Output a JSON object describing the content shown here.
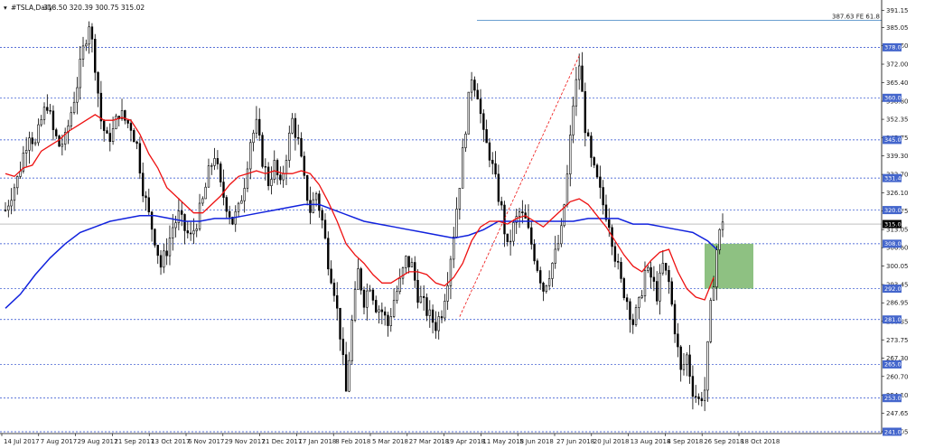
{
  "header": {
    "symbol": "#TSLA,Daily",
    "ohlc": "318.50 320.39 300.75 315.02"
  },
  "colors": {
    "up": "#000000",
    "down": "#000000",
    "ma_fast": "#ee1111",
    "ma_slow": "#1122dd",
    "level_line": "#2244cc",
    "level_label": "#4466cc",
    "zone": "#7ab66c",
    "fib_line": "#3a7fc0",
    "fib_text": "#3a7fc0",
    "price_tag": "#000000"
  },
  "chart_data": {
    "type": "candlestick",
    "title": "#TSLA,Daily",
    "ylim": [
      241.0,
      391.0
    ],
    "y_ticks": [
      "391.15",
      "385.05",
      "378.60",
      "372.00",
      "365.40",
      "358.80",
      "352.35",
      "345.75",
      "339.30",
      "332.70",
      "326.10",
      "319.75",
      "313.05",
      "306.60",
      "300.05",
      "293.45",
      "286.95",
      "280.35",
      "273.75",
      "267.30",
      "260.70",
      "254.10",
      "247.65",
      "241.05"
    ],
    "x_ticks": [
      "14 Jul 2017",
      "7 Aug 2017",
      "29 Aug 2017",
      "21 Sep 2017",
      "13 Oct 2017",
      "6 Nov 2017",
      "29 Nov 2017",
      "21 Dec 2017",
      "17 Jan 2018",
      "8 Feb 2018",
      "5 Mar 2018",
      "27 Mar 2018",
      "19 Apr 2018",
      "11 May 2018",
      "5 Jun 2018",
      "27 Jun 2018",
      "20 Jul 2018",
      "13 Aug 2018",
      "4 Sep 2018",
      "26 Sep 2018",
      "18 Oct 2018"
    ],
    "levels": [
      {
        "value": 378.0,
        "label": "378.00"
      },
      {
        "value": 360.0,
        "label": "360.00"
      },
      {
        "value": 345.0,
        "label": "345.00"
      },
      {
        "value": 331.4,
        "label": "331.40"
      },
      {
        "value": 320.0,
        "label": "320.00"
      },
      {
        "value": 308.0,
        "label": "308.00"
      },
      {
        "value": 292.0,
        "label": "292.00"
      },
      {
        "value": 281.0,
        "label": "281.00"
      },
      {
        "value": 265.0,
        "label": "265.00"
      },
      {
        "value": 253.0,
        "label": "253.00"
      },
      {
        "value": 241.0,
        "label": "241.00"
      }
    ],
    "current_price": {
      "value": 315.02,
      "label": "315.02"
    },
    "fib": {
      "value": 387.63,
      "label": "387.63 FE 61.8"
    },
    "zone": {
      "y_top": 308.0,
      "y_bottom": 292.0
    },
    "close_points": [
      [
        0,
        320
      ],
      [
        4,
        326
      ],
      [
        8,
        331
      ],
      [
        12,
        340
      ],
      [
        16,
        348
      ],
      [
        20,
        343
      ],
      [
        24,
        352
      ],
      [
        28,
        358
      ],
      [
        32,
        348
      ],
      [
        36,
        343
      ],
      [
        40,
        345
      ],
      [
        44,
        355
      ],
      [
        48,
        365
      ],
      [
        52,
        377
      ],
      [
        56,
        387
      ],
      [
        60,
        372
      ],
      [
        64,
        352
      ],
      [
        68,
        345
      ],
      [
        72,
        348
      ],
      [
        76,
        355
      ],
      [
        80,
        352
      ],
      [
        84,
        350
      ],
      [
        88,
        343
      ],
      [
        92,
        328
      ],
      [
        96,
        318
      ],
      [
        100,
        310
      ],
      [
        104,
        300
      ],
      [
        108,
        306
      ],
      [
        112,
        314
      ],
      [
        116,
        318
      ],
      [
        120,
        313
      ],
      [
        124,
        310
      ],
      [
        128,
        316
      ],
      [
        132,
        323
      ],
      [
        136,
        333
      ],
      [
        140,
        340
      ],
      [
        144,
        328
      ],
      [
        148,
        322
      ],
      [
        152,
        316
      ],
      [
        156,
        320
      ],
      [
        160,
        330
      ],
      [
        164,
        345
      ],
      [
        168,
        350
      ],
      [
        172,
        338
      ],
      [
        176,
        330
      ],
      [
        180,
        336
      ],
      [
        184,
        328
      ],
      [
        188,
        340
      ],
      [
        192,
        352
      ],
      [
        196,
        344
      ],
      [
        200,
        330
      ],
      [
        204,
        320
      ],
      [
        208,
        326
      ],
      [
        212,
        316
      ],
      [
        216,
        302
      ],
      [
        220,
        292
      ],
      [
        224,
        276
      ],
      [
        228,
        255
      ],
      [
        232,
        280
      ],
      [
        236,
        298
      ],
      [
        240,
        288
      ],
      [
        244,
        294
      ],
      [
        248,
        286
      ],
      [
        252,
        284
      ],
      [
        256,
        279
      ],
      [
        260,
        288
      ],
      [
        264,
        294
      ],
      [
        268,
        302
      ],
      [
        272,
        300
      ],
      [
        276,
        290
      ],
      [
        280,
        286
      ],
      [
        284,
        282
      ],
      [
        288,
        279
      ],
      [
        292,
        284
      ],
      [
        296,
        296
      ],
      [
        300,
        312
      ],
      [
        304,
        330
      ],
      [
        308,
        350
      ],
      [
        312,
        368
      ],
      [
        316,
        362
      ],
      [
        320,
        346
      ],
      [
        324,
        340
      ],
      [
        328,
        330
      ],
      [
        332,
        320
      ],
      [
        336,
        306
      ],
      [
        340,
        314
      ],
      [
        344,
        319
      ],
      [
        348,
        316
      ],
      [
        352,
        308
      ],
      [
        356,
        300
      ],
      [
        360,
        292
      ],
      [
        364,
        298
      ],
      [
        368,
        304
      ],
      [
        372,
        312
      ],
      [
        376,
        332
      ],
      [
        380,
        358
      ],
      [
        384,
        372
      ],
      [
        388,
        350
      ],
      [
        392,
        337
      ],
      [
        396,
        330
      ],
      [
        400,
        322
      ],
      [
        404,
        316
      ],
      [
        408,
        304
      ],
      [
        412,
        294
      ],
      [
        416,
        288
      ],
      [
        420,
        280
      ],
      [
        424,
        286
      ],
      [
        428,
        298
      ],
      [
        432,
        296
      ],
      [
        436,
        290
      ],
      [
        440,
        300
      ],
      [
        444,
        294
      ],
      [
        448,
        278
      ],
      [
        452,
        262
      ],
      [
        456,
        268
      ],
      [
        460,
        256
      ],
      [
        464,
        252
      ],
      [
        468,
        256
      ],
      [
        472,
        285
      ],
      [
        476,
        306
      ],
      [
        480,
        317
      ]
    ],
    "ma_fast": [
      [
        0,
        333
      ],
      [
        6,
        332
      ],
      [
        12,
        335
      ],
      [
        18,
        336
      ],
      [
        24,
        341
      ],
      [
        30,
        343
      ],
      [
        36,
        345
      ],
      [
        42,
        348
      ],
      [
        48,
        350
      ],
      [
        54,
        352
      ],
      [
        60,
        354
      ],
      [
        66,
        352
      ],
      [
        72,
        352
      ],
      [
        78,
        353
      ],
      [
        84,
        352
      ],
      [
        90,
        347
      ],
      [
        96,
        340
      ],
      [
        102,
        335
      ],
      [
        108,
        328
      ],
      [
        114,
        325
      ],
      [
        120,
        322
      ],
      [
        126,
        319
      ],
      [
        132,
        319
      ],
      [
        138,
        322
      ],
      [
        144,
        325
      ],
      [
        150,
        329
      ],
      [
        156,
        332
      ],
      [
        162,
        333
      ],
      [
        168,
        334
      ],
      [
        174,
        333
      ],
      [
        180,
        334
      ],
      [
        186,
        333
      ],
      [
        192,
        333
      ],
      [
        198,
        334
      ],
      [
        204,
        333
      ],
      [
        210,
        329
      ],
      [
        216,
        323
      ],
      [
        222,
        316
      ],
      [
        228,
        308
      ],
      [
        234,
        304
      ],
      [
        240,
        301
      ],
      [
        246,
        297
      ],
      [
        252,
        294
      ],
      [
        258,
        294
      ],
      [
        264,
        296
      ],
      [
        270,
        298
      ],
      [
        276,
        298
      ],
      [
        282,
        297
      ],
      [
        288,
        294
      ],
      [
        294,
        293
      ],
      [
        300,
        296
      ],
      [
        306,
        301
      ],
      [
        312,
        309
      ],
      [
        318,
        314
      ],
      [
        324,
        316
      ],
      [
        330,
        316
      ],
      [
        336,
        315
      ],
      [
        342,
        317
      ],
      [
        348,
        318
      ],
      [
        354,
        316
      ],
      [
        360,
        314
      ],
      [
        366,
        317
      ],
      [
        372,
        320
      ],
      [
        378,
        323
      ],
      [
        384,
        324
      ],
      [
        390,
        322
      ],
      [
        396,
        318
      ],
      [
        402,
        314
      ],
      [
        408,
        309
      ],
      [
        414,
        304
      ],
      [
        420,
        300
      ],
      [
        426,
        298
      ],
      [
        432,
        302
      ],
      [
        438,
        305
      ],
      [
        444,
        306
      ],
      [
        450,
        298
      ],
      [
        456,
        292
      ],
      [
        462,
        289
      ],
      [
        468,
        288
      ],
      [
        474,
        296
      ]
    ],
    "ma_slow": [
      [
        0,
        285
      ],
      [
        10,
        290
      ],
      [
        20,
        297
      ],
      [
        30,
        303
      ],
      [
        40,
        308
      ],
      [
        50,
        312
      ],
      [
        60,
        314
      ],
      [
        70,
        316
      ],
      [
        80,
        317
      ],
      [
        90,
        318
      ],
      [
        100,
        318
      ],
      [
        110,
        317
      ],
      [
        120,
        316
      ],
      [
        130,
        316
      ],
      [
        140,
        317
      ],
      [
        150,
        317
      ],
      [
        160,
        318
      ],
      [
        170,
        319
      ],
      [
        180,
        320
      ],
      [
        190,
        321
      ],
      [
        200,
        322
      ],
      [
        210,
        322
      ],
      [
        220,
        320
      ],
      [
        230,
        318
      ],
      [
        240,
        316
      ],
      [
        250,
        315
      ],
      [
        260,
        314
      ],
      [
        270,
        313
      ],
      [
        280,
        312
      ],
      [
        290,
        311
      ],
      [
        300,
        310
      ],
      [
        310,
        311
      ],
      [
        320,
        313
      ],
      [
        330,
        316
      ],
      [
        340,
        316
      ],
      [
        350,
        316
      ],
      [
        360,
        316
      ],
      [
        370,
        316
      ],
      [
        380,
        316
      ],
      [
        390,
        317
      ],
      [
        400,
        317
      ],
      [
        410,
        317
      ],
      [
        420,
        315
      ],
      [
        430,
        315
      ],
      [
        440,
        314
      ],
      [
        450,
        313
      ],
      [
        460,
        312
      ],
      [
        470,
        309
      ],
      [
        476,
        306
      ]
    ]
  }
}
